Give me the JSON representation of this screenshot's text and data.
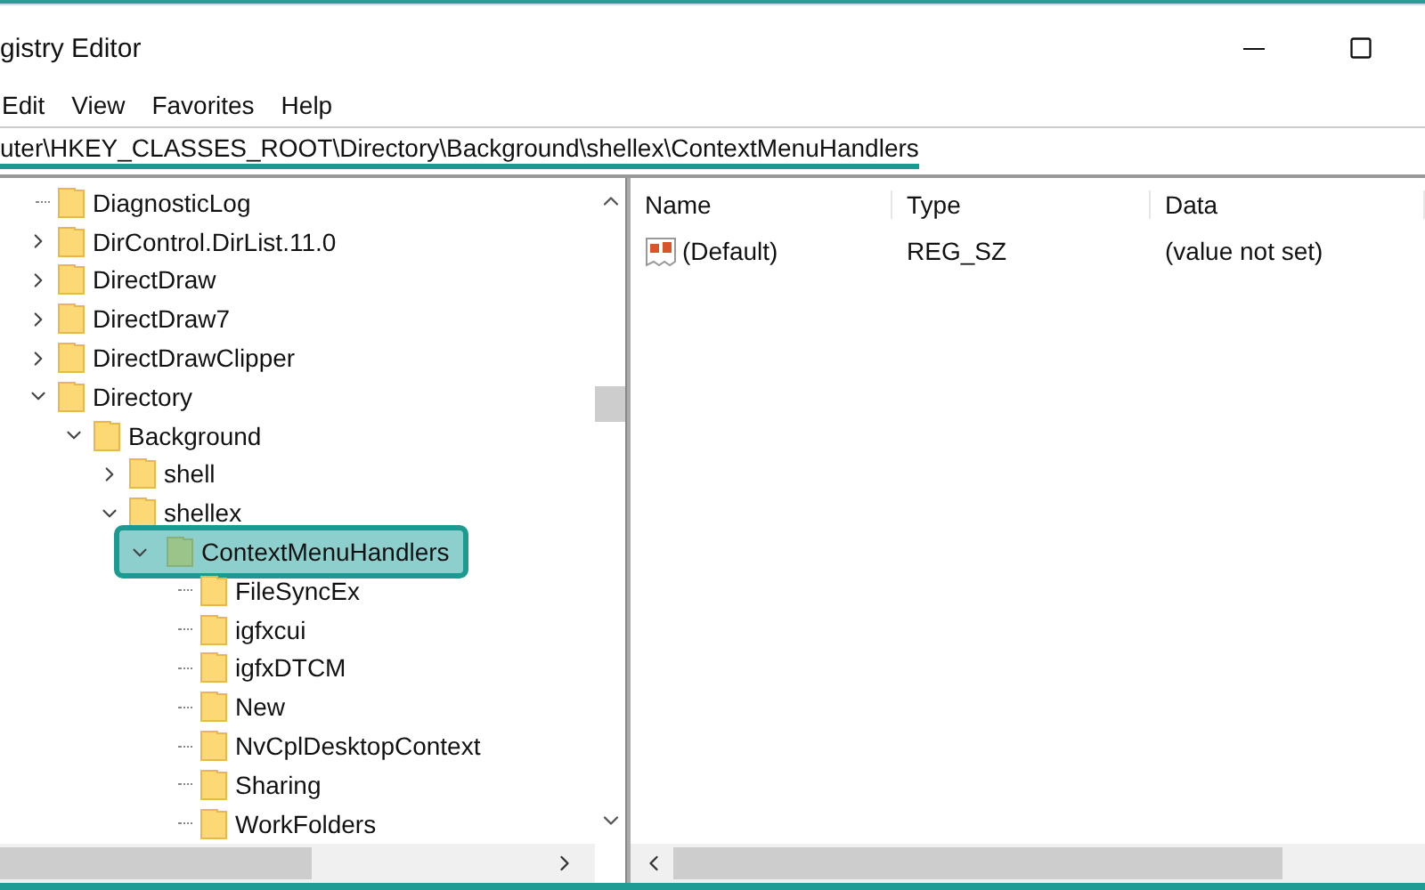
{
  "window": {
    "title": "gistry Editor"
  },
  "menu": [
    "Edit",
    "View",
    "Favorites",
    "Help"
  ],
  "address": "uter\\HKEY_CLASSES_ROOT\\Directory\\Background\\shellex\\ContextMenuHandlers",
  "tree": [
    {
      "label": "DiagnosticLog",
      "kind": "leaf",
      "selected": false
    },
    {
      "label": "DirControl.DirList.11.0",
      "kind": "branch",
      "expanded": false,
      "selected": false
    },
    {
      "label": "DirectDraw",
      "kind": "branch",
      "expanded": false,
      "selected": false
    },
    {
      "label": "DirectDraw7",
      "kind": "branch",
      "expanded": false,
      "selected": false
    },
    {
      "label": "DirectDrawClipper",
      "kind": "branch",
      "expanded": false,
      "selected": false
    },
    {
      "label": "Directory",
      "kind": "branch",
      "expanded": true,
      "selected": false,
      "children": [
        {
          "label": "Background",
          "kind": "branch",
          "expanded": true,
          "selected": false,
          "children": [
            {
              "label": "shell",
              "kind": "branch",
              "expanded": false,
              "selected": false
            },
            {
              "label": "shellex",
              "kind": "branch",
              "expanded": true,
              "selected": false,
              "children": [
                {
                  "label": "ContextMenuHandlers",
                  "kind": "branch",
                  "expanded": true,
                  "selected": true,
                  "children": [
                    {
                      "label": "FileSyncEx",
                      "kind": "leaf",
                      "selected": false
                    },
                    {
                      "label": "igfxcui",
                      "kind": "leaf",
                      "selected": false
                    },
                    {
                      "label": "igfxDTCM",
                      "kind": "leaf",
                      "selected": false
                    },
                    {
                      "label": "New",
                      "kind": "leaf",
                      "selected": false
                    },
                    {
                      "label": "NvCplDesktopContext",
                      "kind": "leaf",
                      "selected": false
                    },
                    {
                      "label": "Sharing",
                      "kind": "leaf",
                      "selected": false
                    },
                    {
                      "label": "WorkFolders",
                      "kind": "leaf",
                      "selected": false
                    }
                  ]
                }
              ]
            }
          ]
        }
      ]
    }
  ],
  "values": {
    "columns": [
      "Name",
      "Type",
      "Data"
    ],
    "rows": [
      {
        "name": "(Default)",
        "type": "REG_SZ",
        "data": "(value not set)"
      }
    ]
  }
}
